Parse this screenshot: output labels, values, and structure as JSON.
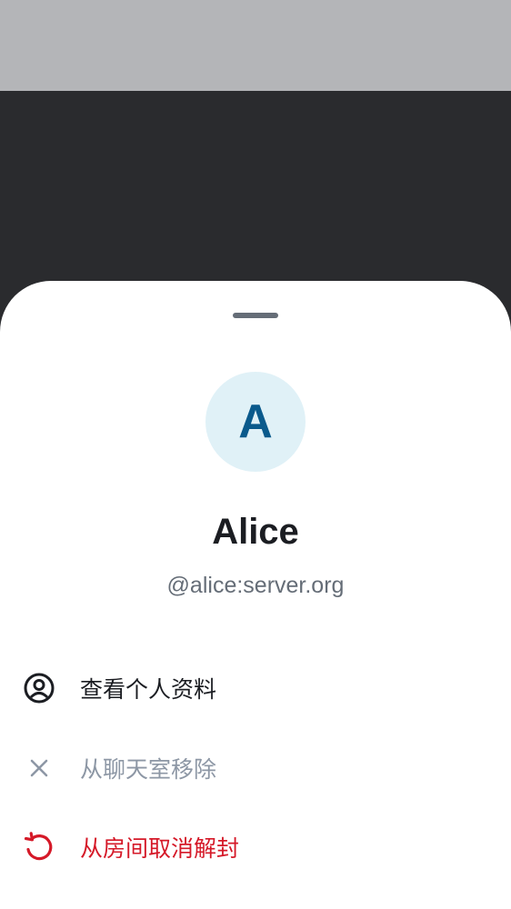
{
  "colors": {
    "status_area": "#b4b5b8",
    "scrim": "#2a2b2e",
    "sheet": "#ffffff",
    "avatar_bg": "#e0f1f7",
    "avatar_text": "#0a5a8c",
    "primary_text": "#1b1d22",
    "secondary_text": "#656d77",
    "disabled_text": "#8d97a5",
    "critical": "#d51928"
  },
  "user": {
    "avatar_initial": "A",
    "display_name": "Alice",
    "user_id": "@alice:server.org"
  },
  "actions": [
    {
      "label": "查看个人资料",
      "icon": "user-profile-icon",
      "state": "enabled"
    },
    {
      "label": "从聊天室移除",
      "icon": "close-icon",
      "state": "disabled"
    },
    {
      "label": "从房间取消解封",
      "icon": "restore-icon",
      "state": "critical"
    }
  ]
}
